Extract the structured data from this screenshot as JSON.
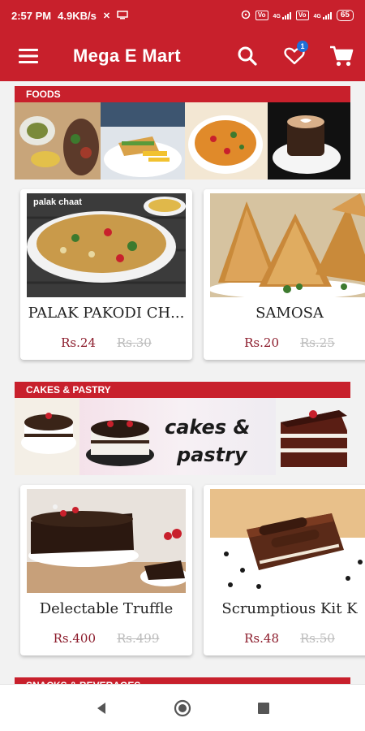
{
  "status_bar": {
    "time": "2:57 PM",
    "speed": "4.9KB/s",
    "sim1": "4G",
    "sim2": "4G",
    "battery": "65"
  },
  "app_bar": {
    "title": "Mega E Mart",
    "wishlist_count": "1",
    "icons": [
      "menu-icon",
      "search-icon",
      "heart-icon",
      "cart-icon"
    ]
  },
  "sections": [
    {
      "header": "FOODS",
      "products": [
        {
          "name": "PALAK PAKODI CH...",
          "price": "Rs.24",
          "old_price": "Rs.30",
          "image_label": "palak chaat"
        },
        {
          "name": "SAMOSA",
          "price": "Rs.20",
          "old_price": "Rs.25"
        }
      ]
    },
    {
      "header": "CAKES & PASTRY",
      "banner_text_1": "cakes &",
      "banner_text_2": "pastry",
      "products": [
        {
          "name": "Delectable Truffle",
          "price": "Rs.400",
          "old_price": "Rs.499"
        },
        {
          "name": "Scrumptious Kit K",
          "price": "Rs.48",
          "old_price": "Rs.50"
        }
      ]
    },
    {
      "header": "SNACKS & BEVERAGES"
    }
  ],
  "nav_bar": {
    "icons": [
      "back-icon",
      "home-icon",
      "recents-icon"
    ]
  },
  "colors": {
    "primary": "#c8202c",
    "price": "#8b1a2a",
    "old_price": "#bcbcbc",
    "badge": "#1e6fd6"
  }
}
